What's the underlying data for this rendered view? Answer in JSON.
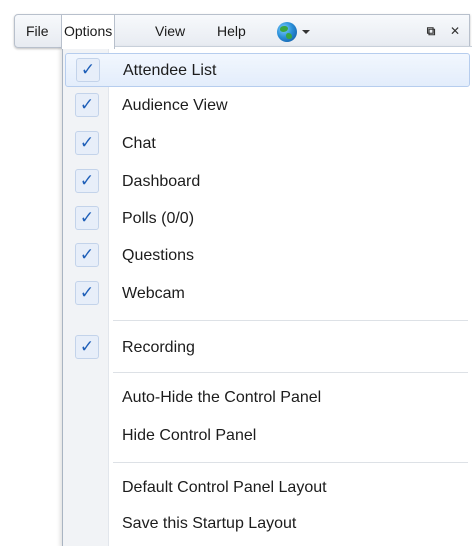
{
  "menubar": {
    "file": "File",
    "options": "Options",
    "view": "View",
    "help": "Help",
    "globe_icon": "globe-icon",
    "restore_symbol": "⧉",
    "close_symbol": "✕"
  },
  "options_menu": {
    "checkmark": "✓",
    "items": [
      {
        "label": "Attendee List",
        "checked": true
      },
      {
        "label": "Audience View",
        "checked": true
      },
      {
        "label": "Chat",
        "checked": true
      },
      {
        "label": "Dashboard",
        "checked": true
      },
      {
        "label": "Polls (0/0)",
        "checked": true
      },
      {
        "label": "Questions",
        "checked": true
      },
      {
        "label": "Webcam",
        "checked": true
      },
      {
        "label": "Recording",
        "checked": true
      },
      {
        "label": "Auto-Hide the Control Panel",
        "checked": false
      },
      {
        "label": "Hide Control Panel",
        "checked": false
      },
      {
        "label": "Default Control Panel Layout",
        "checked": false
      },
      {
        "label": "Save this Startup Layout",
        "checked": false
      }
    ]
  },
  "colors": {
    "check": "#1f5fb8",
    "highlight_border": "#b6cdee",
    "gutter": "#f1f3f6"
  }
}
